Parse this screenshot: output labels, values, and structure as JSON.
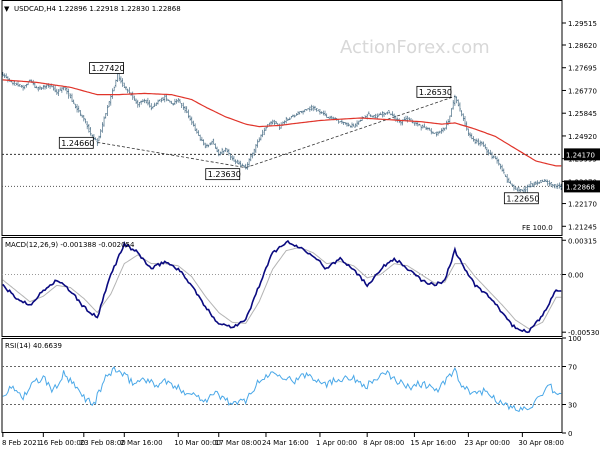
{
  "header": {
    "symbol_line": "USDCAD,H4 1.22896 1.22918 1.22830 1.22868",
    "watermark": "ActionForex.com"
  },
  "chart_data": {
    "type": "candlestick",
    "main": {
      "ylim": [
        1.2085,
        1.3045
      ],
      "ticks": [
        {
          "v": 1.29515,
          "label": "1.29515"
        },
        {
          "v": 1.2862,
          "label": "1.28620"
        },
        {
          "v": 1.27695,
          "label": "1.27695"
        },
        {
          "v": 1.2677,
          "label": "1.26770"
        },
        {
          "v": 1.25845,
          "label": "1.25845"
        },
        {
          "v": 1.2492,
          "label": "1.24920"
        },
        {
          "v": 1.23995,
          "label": "1.23995"
        },
        {
          "v": 1.2307,
          "label": "1.23070"
        },
        {
          "v": 1.2217,
          "label": "1.22170"
        },
        {
          "v": 1.21245,
          "label": "1.21245"
        }
      ],
      "level_line": {
        "v": 1.2417,
        "label": "1.24170",
        "color": "#000000"
      },
      "last_price": {
        "v": 1.22868,
        "label": "1.22868",
        "color": "#000000"
      },
      "indicator_label": "FE 100.0",
      "price_labels": [
        {
          "label": "1.27420",
          "v": 1.2742
        },
        {
          "label": "1.24660",
          "v": 1.2466
        },
        {
          "label": "1.23630",
          "v": 1.2363
        },
        {
          "label": "1.26530",
          "v": 1.2653
        },
        {
          "label": "1.22650",
          "v": 1.2265
        }
      ],
      "price_series": [
        [
          0,
          1.274
        ],
        [
          4,
          1.2715
        ],
        [
          8,
          1.27
        ],
        [
          12,
          1.269
        ],
        [
          16,
          1.272
        ],
        [
          20,
          1.2685
        ],
        [
          24,
          1.269
        ],
        [
          28,
          1.27
        ],
        [
          32,
          1.267
        ],
        [
          36,
          1.269
        ],
        [
          40,
          1.265
        ],
        [
          44,
          1.26
        ],
        [
          48,
          1.256
        ],
        [
          52,
          1.25
        ],
        [
          56,
          1.2466
        ],
        [
          60,
          1.256
        ],
        [
          64,
          1.265
        ],
        [
          68,
          1.2742
        ],
        [
          72,
          1.269
        ],
        [
          76,
          1.266
        ],
        [
          80,
          1.262
        ],
        [
          84,
          1.264
        ],
        [
          88,
          1.261
        ],
        [
          92,
          1.263
        ],
        [
          96,
          1.265
        ],
        [
          100,
          1.262
        ],
        [
          104,
          1.264
        ],
        [
          108,
          1.26
        ],
        [
          112,
          1.255
        ],
        [
          116,
          1.249
        ],
        [
          120,
          1.245
        ],
        [
          124,
          1.247
        ],
        [
          128,
          1.242
        ],
        [
          132,
          1.244
        ],
        [
          136,
          1.24
        ],
        [
          140,
          1.238
        ],
        [
          144,
          1.2363
        ],
        [
          148,
          1.242
        ],
        [
          152,
          1.248
        ],
        [
          156,
          1.253
        ],
        [
          160,
          1.255
        ],
        [
          164,
          1.253
        ],
        [
          168,
          1.256
        ],
        [
          172,
          1.257
        ],
        [
          176,
          1.259
        ],
        [
          180,
          1.26
        ],
        [
          184,
          1.261
        ],
        [
          188,
          1.259
        ],
        [
          192,
          1.257
        ],
        [
          196,
          1.256
        ],
        [
          200,
          1.255
        ],
        [
          204,
          1.254
        ],
        [
          208,
          1.253
        ],
        [
          212,
          1.256
        ],
        [
          216,
          1.258
        ],
        [
          220,
          1.257
        ],
        [
          224,
          1.258
        ],
        [
          228,
          1.259
        ],
        [
          232,
          1.257
        ],
        [
          236,
          1.255
        ],
        [
          240,
          1.256
        ],
        [
          244,
          1.254
        ],
        [
          248,
          1.253
        ],
        [
          252,
          1.252
        ],
        [
          256,
          1.25
        ],
        [
          260,
          1.251
        ],
        [
          264,
          1.255
        ],
        [
          268,
          1.2653
        ],
        [
          272,
          1.258
        ],
        [
          276,
          1.25
        ],
        [
          280,
          1.247
        ],
        [
          284,
          1.246
        ],
        [
          288,
          1.242
        ],
        [
          292,
          1.24
        ],
        [
          296,
          1.235
        ],
        [
          300,
          1.23
        ],
        [
          304,
          1.228
        ],
        [
          308,
          1.2265
        ],
        [
          312,
          1.229
        ],
        [
          316,
          1.23
        ],
        [
          320,
          1.231
        ],
        [
          324,
          1.23
        ],
        [
          328,
          1.2287
        ]
      ],
      "ma_series": [
        [
          0,
          1.272
        ],
        [
          20,
          1.271
        ],
        [
          40,
          1.269
        ],
        [
          56,
          1.266
        ],
        [
          68,
          1.266
        ],
        [
          84,
          1.2665
        ],
        [
          100,
          1.266
        ],
        [
          112,
          1.264
        ],
        [
          120,
          1.261
        ],
        [
          132,
          1.257
        ],
        [
          144,
          1.254
        ],
        [
          152,
          1.253
        ],
        [
          164,
          1.2535
        ],
        [
          176,
          1.2545
        ],
        [
          188,
          1.2555
        ],
        [
          200,
          1.256
        ],
        [
          212,
          1.2565
        ],
        [
          224,
          1.256
        ],
        [
          236,
          1.2555
        ],
        [
          248,
          1.255
        ],
        [
          260,
          1.254
        ],
        [
          268,
          1.2545
        ],
        [
          280,
          1.252
        ],
        [
          292,
          1.249
        ],
        [
          304,
          1.244
        ],
        [
          316,
          1.239
        ],
        [
          328,
          1.237
        ]
      ],
      "trendlines": [
        {
          "from": [
            56,
            1.2466
          ],
          "to": [
            144,
            1.2363
          ]
        },
        {
          "from": [
            144,
            1.2363
          ],
          "to": [
            268,
            1.2653
          ]
        }
      ]
    },
    "macd": {
      "label": "MACD(12,26,9) -0.001388 -0.002054",
      "ylim": [
        -0.00575,
        0.00345
      ],
      "ticks": [
        {
          "v": 0.00315,
          "label": "0.00315"
        },
        {
          "v": 0.0,
          "label": "0.00"
        },
        {
          "v": -0.005307,
          "label": "-0.005307"
        }
      ],
      "main": [
        [
          0,
          -0.001
        ],
        [
          8,
          -0.0022
        ],
        [
          16,
          -0.0028
        ],
        [
          24,
          -0.0015
        ],
        [
          32,
          -0.0005
        ],
        [
          40,
          -0.0015
        ],
        [
          48,
          -0.003
        ],
        [
          56,
          -0.004
        ],
        [
          64,
          0.0
        ],
        [
          72,
          0.0028
        ],
        [
          80,
          0.002
        ],
        [
          88,
          0.0005
        ],
        [
          96,
          0.0012
        ],
        [
          104,
          0.0005
        ],
        [
          112,
          -0.001
        ],
        [
          120,
          -0.003
        ],
        [
          128,
          -0.0045
        ],
        [
          136,
          -0.0048
        ],
        [
          144,
          -0.0042
        ],
        [
          152,
          -0.001
        ],
        [
          160,
          0.002
        ],
        [
          168,
          0.003
        ],
        [
          176,
          0.0025
        ],
        [
          184,
          0.0018
        ],
        [
          192,
          0.0005
        ],
        [
          200,
          0.0015
        ],
        [
          208,
          0.0005
        ],
        [
          216,
          -0.001
        ],
        [
          224,
          0.0005
        ],
        [
          232,
          0.0015
        ],
        [
          240,
          0.0005
        ],
        [
          248,
          -0.0005
        ],
        [
          256,
          -0.001
        ],
        [
          262,
          -0.0005
        ],
        [
          268,
          0.0022
        ],
        [
          274,
          0.0005
        ],
        [
          280,
          -0.001
        ],
        [
          288,
          -0.002
        ],
        [
          296,
          -0.0035
        ],
        [
          304,
          -0.005
        ],
        [
          312,
          -0.0052
        ],
        [
          320,
          -0.0038
        ],
        [
          328,
          -0.0014
        ]
      ],
      "signal": [
        [
          0,
          -0.0005
        ],
        [
          8,
          -0.0015
        ],
        [
          16,
          -0.0025
        ],
        [
          24,
          -0.002
        ],
        [
          32,
          -0.001
        ],
        [
          40,
          -0.0012
        ],
        [
          48,
          -0.0022
        ],
        [
          56,
          -0.0035
        ],
        [
          64,
          -0.0018
        ],
        [
          72,
          0.001
        ],
        [
          80,
          0.0018
        ],
        [
          88,
          0.001
        ],
        [
          96,
          0.001
        ],
        [
          104,
          0.0008
        ],
        [
          112,
          -0.0002
        ],
        [
          120,
          -0.002
        ],
        [
          128,
          -0.0035
        ],
        [
          136,
          -0.0044
        ],
        [
          144,
          -0.0045
        ],
        [
          152,
          -0.0025
        ],
        [
          160,
          0.0005
        ],
        [
          168,
          0.0022
        ],
        [
          176,
          0.0025
        ],
        [
          184,
          0.002
        ],
        [
          192,
          0.001
        ],
        [
          200,
          0.0012
        ],
        [
          208,
          0.0008
        ],
        [
          216,
          -0.0003
        ],
        [
          224,
          0.0
        ],
        [
          232,
          0.001
        ],
        [
          240,
          0.0008
        ],
        [
          248,
          0.0
        ],
        [
          256,
          -0.0008
        ],
        [
          262,
          -0.0007
        ],
        [
          268,
          0.001
        ],
        [
          274,
          0.001
        ],
        [
          280,
          -0.0002
        ],
        [
          288,
          -0.0015
        ],
        [
          296,
          -0.0028
        ],
        [
          304,
          -0.0042
        ],
        [
          312,
          -0.005
        ],
        [
          320,
          -0.0044
        ],
        [
          328,
          -0.0021
        ]
      ]
    },
    "rsi": {
      "label": "RSI(14) 40.6639",
      "ylim": [
        0,
        100
      ],
      "ticks": [
        {
          "v": 100,
          "label": "100"
        },
        {
          "v": 70,
          "label": "70"
        },
        {
          "v": 30,
          "label": "30"
        },
        {
          "v": 0,
          "label": "0"
        }
      ],
      "values": [
        [
          0,
          40
        ],
        [
          6,
          48
        ],
        [
          12,
          38
        ],
        [
          18,
          52
        ],
        [
          24,
          58
        ],
        [
          30,
          44
        ],
        [
          36,
          62
        ],
        [
          42,
          50
        ],
        [
          48,
          38
        ],
        [
          54,
          30
        ],
        [
          60,
          55
        ],
        [
          66,
          68
        ],
        [
          72,
          60
        ],
        [
          78,
          52
        ],
        [
          84,
          58
        ],
        [
          90,
          50
        ],
        [
          96,
          55
        ],
        [
          102,
          48
        ],
        [
          108,
          44
        ],
        [
          114,
          40
        ],
        [
          120,
          35
        ],
        [
          126,
          42
        ],
        [
          132,
          35
        ],
        [
          138,
          30
        ],
        [
          144,
          35
        ],
        [
          150,
          50
        ],
        [
          156,
          60
        ],
        [
          162,
          65
        ],
        [
          168,
          58
        ],
        [
          174,
          55
        ],
        [
          180,
          62
        ],
        [
          186,
          57
        ],
        [
          192,
          52
        ],
        [
          198,
          56
        ],
        [
          204,
          60
        ],
        [
          210,
          55
        ],
        [
          216,
          50
        ],
        [
          222,
          58
        ],
        [
          228,
          62
        ],
        [
          234,
          55
        ],
        [
          240,
          48
        ],
        [
          246,
          52
        ],
        [
          252,
          50
        ],
        [
          258,
          45
        ],
        [
          264,
          58
        ],
        [
          268,
          66
        ],
        [
          272,
          48
        ],
        [
          278,
          42
        ],
        [
          284,
          44
        ],
        [
          290,
          40
        ],
        [
          296,
          30
        ],
        [
          302,
          26
        ],
        [
          308,
          25
        ],
        [
          314,
          30
        ],
        [
          320,
          38
        ],
        [
          324,
          50
        ],
        [
          328,
          40.66
        ]
      ]
    },
    "x_ticks": [
      {
        "i": 0,
        "label": "8 Feb 2021"
      },
      {
        "i": 24,
        "label": "16 Feb 00:00"
      },
      {
        "i": 48,
        "label": "23 Feb 08:00"
      },
      {
        "i": 72,
        "label": "2 Mar 16:00"
      },
      {
        "i": 104,
        "label": "10 Mar 00:00"
      },
      {
        "i": 128,
        "label": "17 Mar 08:00"
      },
      {
        "i": 156,
        "label": "24 Mar 16:00"
      },
      {
        "i": 188,
        "label": "1 Apr 00:00"
      },
      {
        "i": 216,
        "label": "8 Apr 08:00"
      },
      {
        "i": 244,
        "label": "15 Apr 16:00"
      },
      {
        "i": 276,
        "label": "23 Apr 00:00"
      },
      {
        "i": 308,
        "label": "30 Apr 08:00"
      }
    ],
    "colors": {
      "candle": "#4a6e86",
      "ma": "#e0342a",
      "macd": "#0a0a80",
      "signal": "#b4b4b4",
      "rsi": "#4aa8e8",
      "grid": "#000000"
    }
  }
}
